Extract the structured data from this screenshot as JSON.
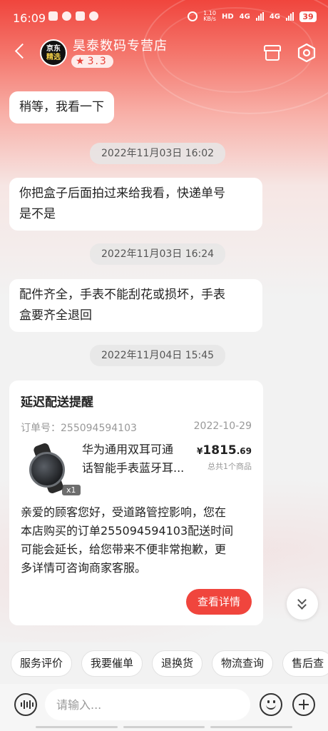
{
  "status_bar": {
    "time": "16:09",
    "net_speed_top": "1.10",
    "net_speed_bottom": "KB/s",
    "hd_label": "HD",
    "signal1": "4G",
    "signal2": "4G",
    "battery": "39"
  },
  "header": {
    "store_logo_line1": "京东",
    "store_logo_line2": "精选",
    "store_name": "昊泰数码专营店",
    "rating": "3.3",
    "icons": [
      "back-arrow-icon",
      "shop-icon",
      "settings-icon"
    ]
  },
  "messages": [
    {
      "type": "text",
      "text": "稍等，我看一下"
    },
    {
      "type": "time",
      "text": "2022年11月03日  16:02"
    },
    {
      "type": "text",
      "lines": [
        "你把盒子后面拍过来给我看，快递单号",
        "是不是"
      ]
    },
    {
      "type": "time",
      "text": "2022年11月03日  16:24"
    },
    {
      "type": "text",
      "lines": [
        "配件齐全，手表不能刮花或损坏，手表",
        "盒要齐全退回"
      ]
    },
    {
      "type": "time",
      "text": "2022年11月04日  15:45"
    }
  ],
  "order_card": {
    "title": "延迟配送提醒",
    "order_no": "订单号：255094594103",
    "date": "2022-10-29",
    "product_name": "华为通用双耳可通话智能手表蓝牙耳机",
    "product_name_lines": [
      "华为通用双耳可通",
      "话智能手表蓝牙耳..."
    ],
    "qty": "x1",
    "price_currency": "¥",
    "price_int": "1815",
    "price_dec": ".69",
    "count_text": "总共1个商品",
    "message_lines": [
      "亲爱的顾客您好，受道路管控影响，您在",
      "本店购买的订单255094594103配送时间",
      "可能会延长，给您带来不便非常抱歉，更",
      "多详情可咨询商家客服。"
    ],
    "detail_button": "查看详情"
  },
  "quick_actions": [
    "服务评价",
    "我要催单",
    "退换货",
    "物流查询",
    "售后查"
  ],
  "input": {
    "placeholder": "请输入..."
  },
  "colors": {
    "accent": "#f0453d",
    "bubble_bg": "#ffffff",
    "page_bg": "#f2f2f2"
  }
}
